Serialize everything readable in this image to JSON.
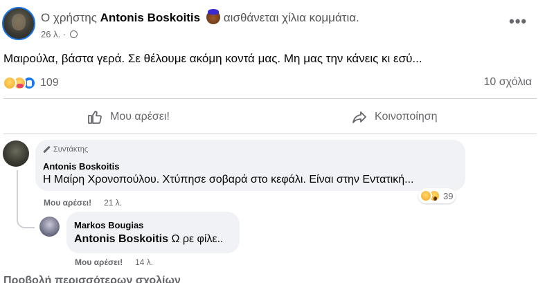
{
  "post": {
    "prefix": "Ο χρήστης",
    "author": "Antonis Boskoitis",
    "feeling": "αισθάνεται χίλια κομμάτια.",
    "time": "26 λ. ·",
    "more_icon": "•••",
    "text": "Μαιρούλα, βάστα γερά. Σε θέλουμε ακόμη κοντά μας. Μη μας την κάνεις κι εσύ...",
    "reaction_icons": [
      "sad-icon",
      "care-icon",
      "like-icon"
    ],
    "reaction_count": "109",
    "comments_count": "10 σχόλια"
  },
  "actions": {
    "like_label": "Μου αρέσει!",
    "share_label": "Κοινοποίηση"
  },
  "comments": [
    {
      "badge": "Συντάκτης",
      "name": "Antonis Boskoitis",
      "text": "Η Μαίρη Χρονοπούλου. Χτύπησε σοβαρά στο κεφάλι. Είναι στην Εντατική...",
      "reaction_count": "39",
      "like_label": "Μου αρέσει!",
      "time": "21 λ."
    },
    {
      "name": "Markos Bougias",
      "mention": "Antonis Boskoitis",
      "text": " Ω ρε φίλε..",
      "like_label": "Μου αρέσει!",
      "time": "14 λ."
    }
  ],
  "more_comments": "Προβολή περισσότερων σχολίων"
}
